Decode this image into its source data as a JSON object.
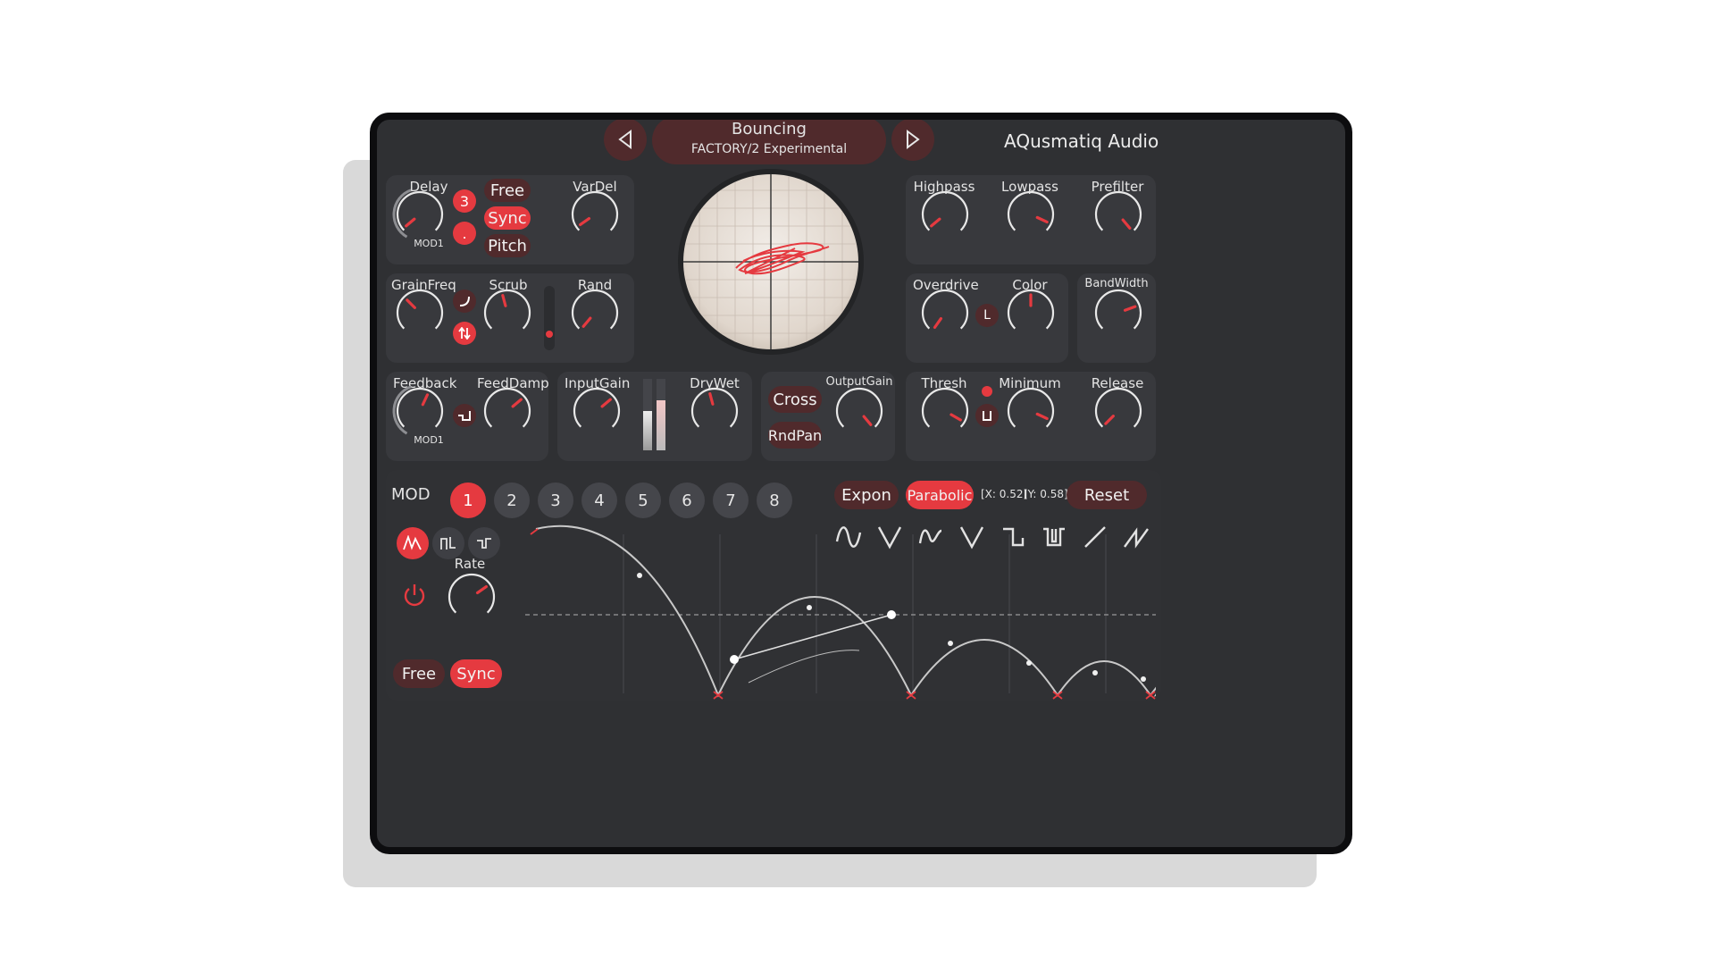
{
  "header": {
    "preset_name": "Bouncing",
    "preset_path": "FACTORY/2 Experimental",
    "brand": "AQusmatiq Audio",
    "prev_icon": "triangle-left-icon",
    "next_icon": "triangle-right-icon"
  },
  "delay": {
    "label": "Delay",
    "mod_label": "MOD1",
    "num": "3",
    "dot": ".",
    "free": "Free",
    "sync": "Sync",
    "pitch": "Pitch",
    "vardel": "VarDel"
  },
  "grain": {
    "grainfreq": "GrainFreq",
    "scrub": "Scrub",
    "rand": "Rand"
  },
  "feedback": {
    "feedback": "Feedback",
    "mod_label": "MOD1",
    "feeddamp": "FeedDamp"
  },
  "gain": {
    "inputgain": "InputGain",
    "drywet": "DryWet"
  },
  "output": {
    "cross": "Cross",
    "rndpan": "RndPan",
    "outputgain": "OutputGain"
  },
  "filters": {
    "highpass": "Highpass",
    "lowpass": "Lowpass",
    "prefilter": "Prefilter"
  },
  "drive": {
    "overdrive": "Overdrive",
    "l": "L",
    "color": "Color",
    "bandwidth": "BandWidth"
  },
  "dynamics": {
    "thresh": "Thresh",
    "minimum": "Minimum",
    "release": "Release"
  },
  "mod": {
    "label": "MOD",
    "slots": [
      "1",
      "2",
      "3",
      "4",
      "5",
      "6",
      "7",
      "8"
    ],
    "active_slot": "1",
    "expon": "Expon",
    "parabolic": "Parabolic",
    "x_readout": "[X: 0.52]",
    "y_readout": "[Y: 0.58]",
    "reset": "Reset",
    "rate": "Rate",
    "free": "Free",
    "sync": "Sync",
    "shapes": [
      "sine-icon",
      "v-shape-icon",
      "sine-small-icon",
      "v-shape-alt-icon",
      "square-pulse-icon",
      "square-inverted-icon",
      "ramp-up-icon",
      "ramp-reset-icon"
    ]
  },
  "colors": {
    "accent": "#e53a40",
    "panel": "#38393d",
    "background": "#2f3033"
  }
}
